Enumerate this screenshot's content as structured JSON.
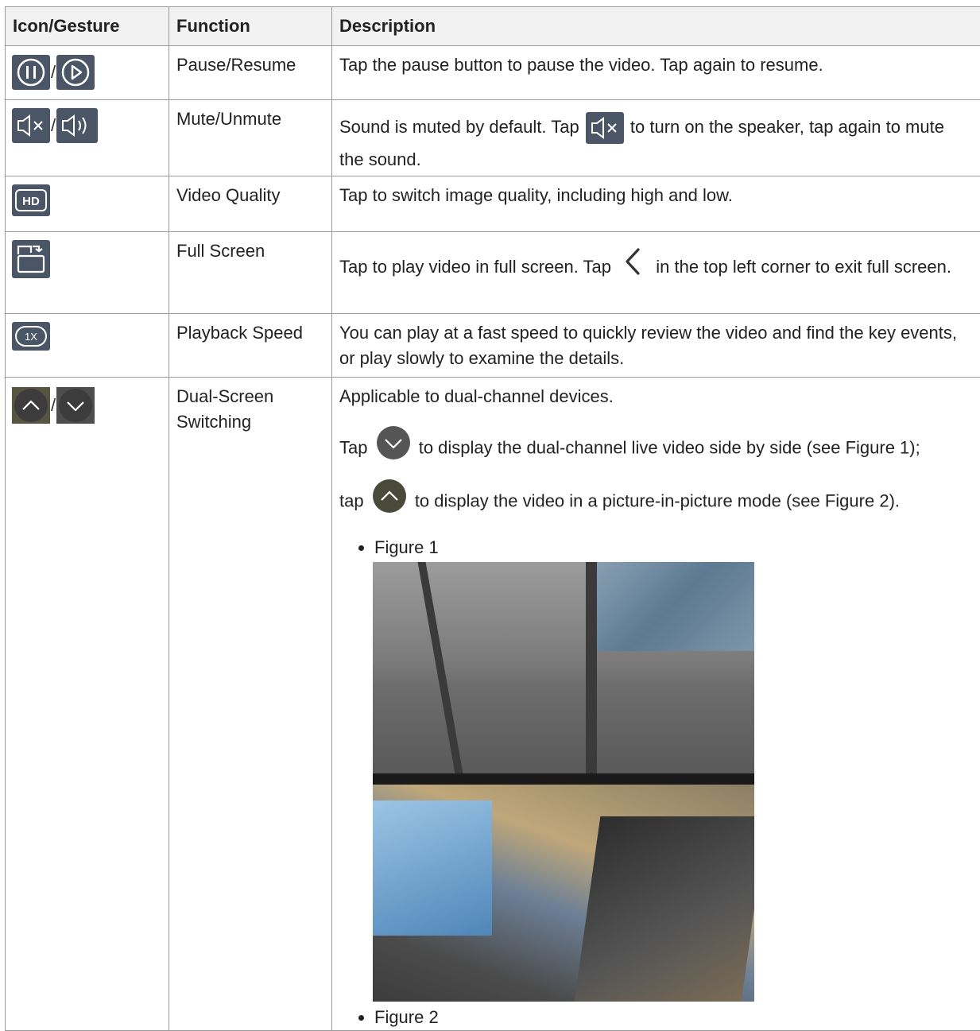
{
  "headers": {
    "icon": "Icon/Gesture",
    "function": "Function",
    "description": "Description"
  },
  "rows": [
    {
      "icons": [
        "pause-icon",
        "play-icon"
      ],
      "sep": "/",
      "function": "Pause/Resume",
      "desc": "Tap the pause button to pause the video. Tap again to resume."
    },
    {
      "icons": [
        "speaker-muted-icon",
        "speaker-on-icon"
      ],
      "sep": "/",
      "function": "Mute/Unmute",
      "desc_a": "Sound is muted by default. Tap ",
      "desc_b": " to turn on the speaker, tap again to mute the sound."
    },
    {
      "icons": [
        "hd-icon"
      ],
      "function": "Video Quality",
      "desc": "Tap to switch image quality, including high and low."
    },
    {
      "icons": [
        "fullscreen-icon"
      ],
      "function": "Full Screen",
      "desc_a": "Tap to play video in full screen. Tap ",
      "desc_b": " in the top left corner to exit full screen."
    },
    {
      "icons": [
        "speed-1x-icon"
      ],
      "function": "Playback Speed",
      "desc": "You can play at a fast speed to quickly review the video and find the key events, or play slowly to examine the details."
    },
    {
      "icons": [
        "chevron-up-icon",
        "chevron-down-icon"
      ],
      "sep": "/",
      "function": "Dual-Screen Switching",
      "desc_1": "Applicable to dual-channel devices.",
      "desc_2a": "Tap ",
      "desc_2b": " to display the dual-channel live video side by side (see Figure 1);",
      "desc_3a": "tap ",
      "desc_3b": " to display the video in a picture-in-picture mode (see Figure 2).",
      "figure_1": "Figure 1",
      "figure_2": "Figure 2"
    }
  ],
  "hd_text": "HD",
  "speed_text": "1X"
}
